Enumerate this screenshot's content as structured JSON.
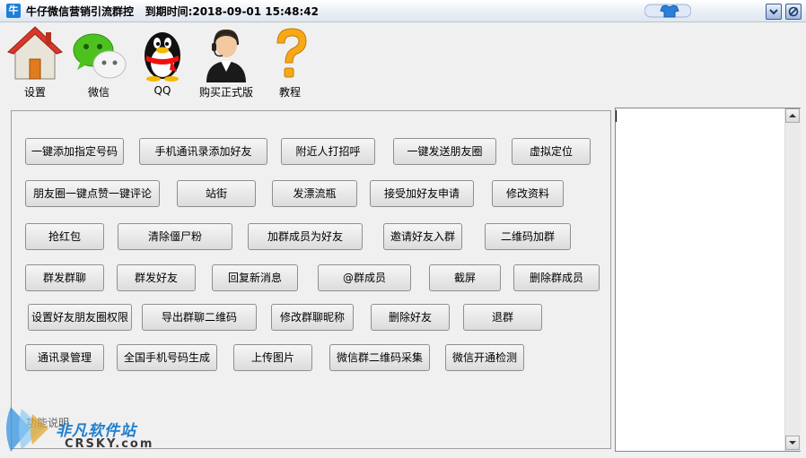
{
  "window": {
    "app_icon_glyph": "牛",
    "title": "牛仔微信营销引流群控",
    "expiry_label": "到期时间:2018-09-01 15:48:42"
  },
  "toolbar": [
    {
      "label": "设置",
      "icon": "house-icon"
    },
    {
      "label": "微信",
      "icon": "wechat-icon"
    },
    {
      "label": "QQ",
      "icon": "qq-penguin-icon"
    },
    {
      "label": "购买正式版",
      "icon": "customer-service-icon"
    },
    {
      "label": "教程",
      "icon": "question-mark-icon"
    }
  ],
  "buttons": {
    "one_click_add_number": "一键添加指定号码",
    "phone_contacts_add_friend": "手机通讯录添加好友",
    "nearby_greet": "附近人打招呼",
    "one_click_post_moments": "一键发送朋友圈",
    "virtual_location": "虚拟定位",
    "moments_like_comment": "朋友圈一键点赞一键评论",
    "stand_street": "站街",
    "drift_bottle": "发漂流瓶",
    "accept_friend_requests": "接受加好友申请",
    "edit_profile": "修改资料",
    "grab_red_packet": "抢红包",
    "clear_zombie_fans": "清除僵尸粉",
    "add_group_members_as_friends": "加群成员为好友",
    "invite_friends_to_group": "邀请好友入群",
    "qr_join_group": "二维码加群",
    "group_send_chat": "群发群聊",
    "group_send_friends": "群发好友",
    "reply_new_message": "回复新消息",
    "at_group_members": "@群成员",
    "screenshot": "截屏",
    "delete_group_members": "删除群成员",
    "set_moments_permission": "设置好友朋友圈权限",
    "export_group_qr": "导出群聊二维码",
    "edit_group_nickname": "修改群聊昵称",
    "delete_friends": "删除好友",
    "quit_group": "退群",
    "contacts_management": "通讯录管理",
    "national_number_generator": "全国手机号码生成",
    "upload_image": "上传图片",
    "wechat_group_qr_collect": "微信群二维码采集",
    "wechat_activation_check": "微信开通检测"
  },
  "panel": {
    "function_description": "功能说明"
  },
  "log_area": {
    "value": ""
  },
  "watermark": {
    "cn": "非凡软件站",
    "en": "CRSKY.com"
  }
}
